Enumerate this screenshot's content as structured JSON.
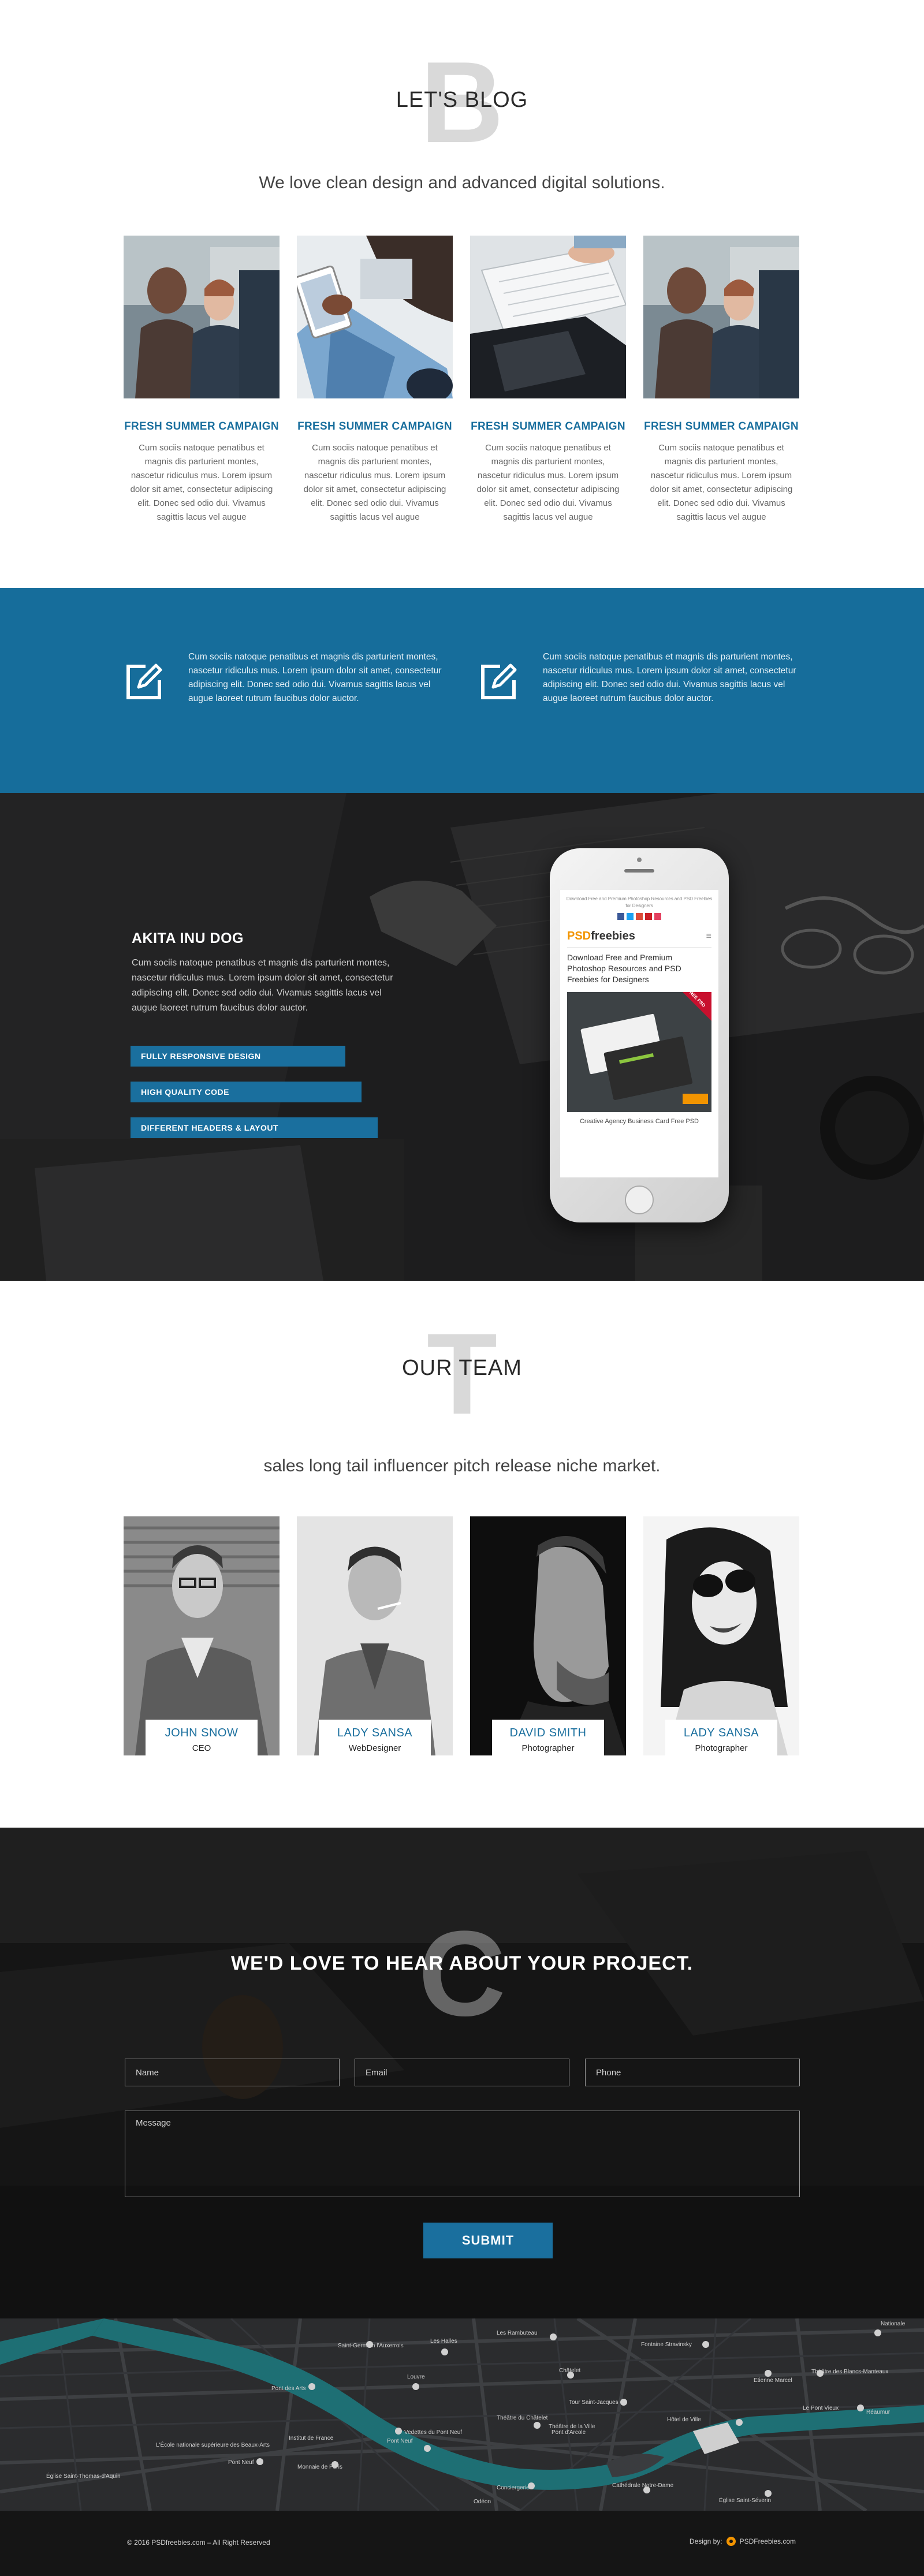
{
  "blog": {
    "big_letter": "B",
    "title": "LET'S BLOG",
    "subtitle": "We love clean design and advanced digital solutions.",
    "cards": [
      {
        "title": "FRESH SUMMER CAMPAIGN",
        "text": "Cum sociis natoque penatibus et magnis dis parturient montes, nascetur ridiculus mus. Lorem ipsum dolor sit amet, consectetur adipiscing elit. Donec sed odio dui. Vivamus sagittis lacus vel augue"
      },
      {
        "title": "FRESH SUMMER CAMPAIGN",
        "text": "Cum sociis natoque penatibus et magnis dis parturient montes, nascetur ridiculus mus. Lorem ipsum dolor sit amet, consectetur adipiscing elit. Donec sed odio dui. Vivamus sagittis lacus vel augue"
      },
      {
        "title": "FRESH SUMMER CAMPAIGN",
        "text": "Cum sociis natoque penatibus et magnis dis parturient montes, nascetur ridiculus mus. Lorem ipsum dolor sit amet, consectetur adipiscing elit. Donec sed odio dui. Vivamus sagittis lacus vel augue"
      },
      {
        "title": "FRESH SUMMER CAMPAIGN",
        "text": "Cum sociis natoque penatibus et magnis dis parturient montes, nascetur ridiculus mus. Lorem ipsum dolor sit amet, consectetur adipiscing elit. Donec sed odio dui. Vivamus sagittis lacus vel augue"
      }
    ]
  },
  "features": [
    {
      "icon": "edit-icon",
      "text": "Cum sociis natoque penatibus et magnis dis parturient montes, nascetur ridiculus mus. Lorem ipsum dolor sit amet, consectetur adipiscing elit. Donec sed odio dui. Vivamus sagittis lacus vel augue laoreet rutrum faucibus dolor auctor."
    },
    {
      "icon": "edit-icon",
      "text": "Cum sociis natoque penatibus et magnis dis parturient montes, nascetur ridiculus mus. Lorem ipsum dolor sit amet, consectetur adipiscing elit. Donec sed odio dui. Vivamus sagittis lacus vel augue laoreet rutrum faucibus dolor auctor."
    }
  ],
  "product": {
    "title": "AKITA INU DOG",
    "text": "Cum sociis natoque penatibus et magnis dis parturient montes, nascetur ridiculus mus. Lorem ipsum dolor sit amet, consectetur adipiscing elit. Donec sed odio dui. Vivamus sagittis lacus vel augue laoreet rutrum faucibus dolor auctor.",
    "pills": [
      "FULLY RESPONSIVE DESIGN",
      "HIGH QUALITY CODE",
      "DIFFERENT HEADERS & LAYOUT"
    ],
    "phone": {
      "top_text": "Download Free and Premium Photoshop Resources and PSD Freebies for Designers",
      "logo_a": "PSD",
      "logo_b": "freebies",
      "menu": "≡",
      "heading": "Download Free and Premium Photoshop Resources and PSD Freebies for Designers",
      "badge": "FREE PSD",
      "caption": "Creative Agency Business Card Free PSD"
    }
  },
  "team": {
    "big_letter": "T",
    "title": "OUR TEAM",
    "subtitle": "sales long tail influencer pitch release niche market.",
    "members": [
      {
        "name": "JOHN SNOW",
        "role": "CEO"
      },
      {
        "name": "LADY SANSA",
        "role": "WebDesigner"
      },
      {
        "name": "DAVID SMITH",
        "role": "Photographer"
      },
      {
        "name": "LADY SANSA",
        "role": "Photographer"
      }
    ]
  },
  "contact": {
    "big_letter": "C",
    "title": "WE'D LOVE TO HEAR ABOUT YOUR PROJECT.",
    "name_placeholder": "Name",
    "email_placeholder": "Email",
    "phone_placeholder": "Phone",
    "message_placeholder": "Message",
    "submit": "SUBMIT"
  },
  "map": {
    "labels": [
      "Saint-Germain l'Auxerrois",
      "Les Halles",
      "Les Rambuteau",
      "Fontaine Stravinsky",
      "Etienne Marcel",
      "Louvre",
      "Pont des Arts",
      "Pont Neuf",
      "Châtelet",
      "Tour Saint-Jacques",
      "Théâtre du Châtelet",
      "Hôtel de Ville",
      "Pont d'Arcole",
      "Vedettes du Pont Neuf",
      "Théâtre de la Ville",
      "Le Pont Vieux",
      "Théâtre des Blancs-Manteaux",
      "Institut de France",
      "Monnaie de Paris",
      "Conciergerie",
      "Cathédrale Notre-Dame",
      "Église Saint-Séverin",
      "L'École nationale supérieure des Beaux-Arts",
      "Église Saint-Thomas-d'Aquin",
      "Pont Neuf",
      "Odéon",
      "Réaumur",
      "Nationale"
    ],
    "accent": "#1e6f74"
  },
  "footer": {
    "copyright": "© 2016 PSDfreebies.com – All Right Reserved",
    "design_label": "Design by:",
    "design_brand": "PSDFreebies.com"
  },
  "colors": {
    "accent": "#1a6f9e",
    "feature_bg": "#166d9b",
    "dark_bg": "#1b1b1c"
  }
}
